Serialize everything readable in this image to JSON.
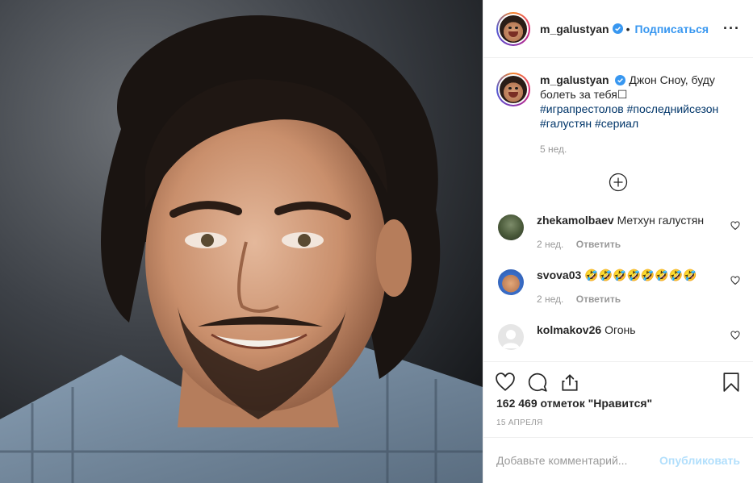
{
  "post": {
    "username": "m_galustyan",
    "follow_label": "Подписаться",
    "more_icon": "more-icon"
  },
  "caption": {
    "username": "m_galustyan",
    "text": "Джон Сноу, буду болеть за тебя☐",
    "hashtags": [
      "#игрaпрестолов",
      "#последнийсезон",
      "#галустян",
      "#сериал"
    ],
    "time": "5 нед."
  },
  "comments": [
    {
      "username": "zhekamolbaev",
      "text": "Метхун галустян",
      "time": "2 нед.",
      "reply": "Ответить"
    },
    {
      "username": "svova03",
      "text": "🤣🤣🤣🤣🤣🤣🤣🤣",
      "time": "2 нед.",
      "reply": "Ответить"
    },
    {
      "username": "kolmakov26",
      "text": "Огонь",
      "time": "",
      "reply": ""
    }
  ],
  "likes": "162 469 отметок \"Нравится\"",
  "date": "15 АПРЕЛЯ",
  "add_comment": {
    "placeholder": "Добавьте комментарий...",
    "publish_label": "Опубликовать"
  },
  "colors": {
    "accent": "#3897f0",
    "hashtag": "#003569",
    "muted": "#999999",
    "publish_disabled": "#b2dffc"
  }
}
